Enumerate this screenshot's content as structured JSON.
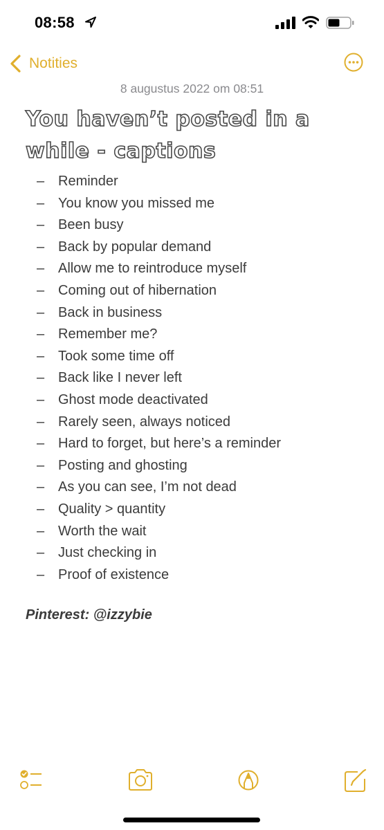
{
  "status_bar": {
    "time": "08:58",
    "icons": [
      "location-arrow-icon",
      "cellular-signal-icon",
      "wifi-icon",
      "battery-icon"
    ],
    "battery_level": 0.5
  },
  "nav": {
    "back_label": "Notities",
    "back_icon": "chevron-left-icon",
    "more_icon": "ellipsis-circle-icon"
  },
  "note": {
    "date": "8 augustus 2022 om 08:51",
    "title": "You haven’t posted in a while - captions",
    "bullet": "–",
    "items": [
      "Reminder",
      "You know you missed me",
      "Been busy",
      "Back by popular demand",
      "Allow me to reintroduce myself",
      "Coming out of hibernation",
      "Back in business",
      "Remember me?",
      "Took some time off",
      "Back like I never left",
      "Ghost mode deactivated",
      "Rarely seen, always noticed",
      "Hard to forget, but here’s a reminder",
      "Posting and ghosting",
      "As you can see, I’m not dead",
      "Quality > quantity",
      "Worth the wait",
      "Just checking in",
      "Proof of existence"
    ],
    "credit": "Pinterest: @izzybie"
  },
  "toolbar": {
    "icons": [
      "checklist-icon",
      "camera-icon",
      "markup-pen-icon",
      "compose-icon"
    ]
  },
  "colors": {
    "accent": "#E0AF2D",
    "text": "#3b3b3b",
    "secondary_text": "#8a8a8e",
    "background": "#ffffff"
  }
}
